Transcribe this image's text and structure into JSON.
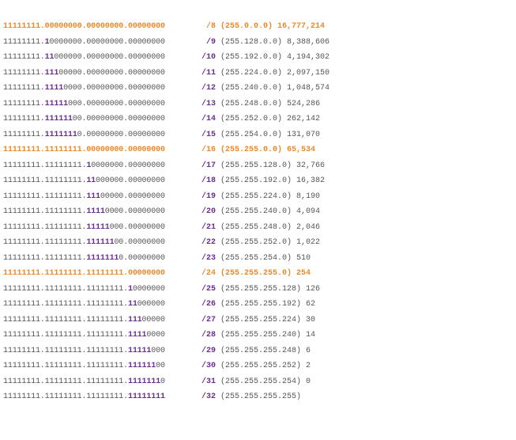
{
  "colors": {
    "text": "#555555",
    "subnet_bits": "#6a2c8f",
    "octet_boundary": "#e8892b"
  },
  "rows": [
    {
      "prefix": "/8",
      "mask": "(255.0.0.0)",
      "hosts": "16,777,214",
      "bits_net": "11111111.",
      "bits_sub": "",
      "bits_rest": "00000000.00000000.00000000",
      "octet_boundary": true
    },
    {
      "prefix": "/9",
      "mask": "(255.128.0.0)",
      "hosts": "8,388,606",
      "bits_net": "11111111.",
      "bits_sub": "1",
      "bits_rest": "0000000.00000000.00000000",
      "octet_boundary": false
    },
    {
      "prefix": "/10",
      "mask": "(255.192.0.0)",
      "hosts": "4,194,302",
      "bits_net": "11111111.",
      "bits_sub": "11",
      "bits_rest": "000000.00000000.00000000",
      "octet_boundary": false
    },
    {
      "prefix": "/11",
      "mask": "(255.224.0.0)",
      "hosts": "2,097,150",
      "bits_net": "11111111.",
      "bits_sub": "111",
      "bits_rest": "00000.00000000.00000000",
      "octet_boundary": false
    },
    {
      "prefix": "/12",
      "mask": "(255.240.0.0)",
      "hosts": "1,048,574",
      "bits_net": "11111111.",
      "bits_sub": "1111",
      "bits_rest": "0000.00000000.00000000",
      "octet_boundary": false
    },
    {
      "prefix": "/13",
      "mask": "(255.248.0.0)",
      "hosts": "524,286",
      "bits_net": "11111111.",
      "bits_sub": "11111",
      "bits_rest": "000.00000000.00000000",
      "octet_boundary": false
    },
    {
      "prefix": "/14",
      "mask": "(255.252.0.0)",
      "hosts": "262,142",
      "bits_net": "11111111.",
      "bits_sub": "111111",
      "bits_rest": "00.00000000.00000000",
      "octet_boundary": false
    },
    {
      "prefix": "/15",
      "mask": "(255.254.0.0)",
      "hosts": "131,070",
      "bits_net": "11111111.",
      "bits_sub": "1111111",
      "bits_rest": "0.00000000.00000000",
      "octet_boundary": false
    },
    {
      "prefix": "/16",
      "mask": "(255.255.0.0)",
      "hosts": "65,534",
      "bits_net": "11111111.11111111.",
      "bits_sub": "",
      "bits_rest": "00000000.00000000",
      "octet_boundary": true
    },
    {
      "prefix": "/17",
      "mask": "(255.255.128.0)",
      "hosts": "32,766",
      "bits_net": "11111111.11111111.",
      "bits_sub": "1",
      "bits_rest": "0000000.00000000",
      "octet_boundary": false
    },
    {
      "prefix": "/18",
      "mask": "(255.255.192.0)",
      "hosts": "16,382",
      "bits_net": "11111111.11111111.",
      "bits_sub": "11",
      "bits_rest": "000000.00000000",
      "octet_boundary": false
    },
    {
      "prefix": "/19",
      "mask": "(255.255.224.0)",
      "hosts": "8,190",
      "bits_net": "11111111.11111111.",
      "bits_sub": "111",
      "bits_rest": "00000.00000000",
      "octet_boundary": false
    },
    {
      "prefix": "/20",
      "mask": "(255.255.240.0)",
      "hosts": "4,094",
      "bits_net": "11111111.11111111.",
      "bits_sub": "1111",
      "bits_rest": "0000.00000000",
      "octet_boundary": false
    },
    {
      "prefix": "/21",
      "mask": "(255.255.248.0)",
      "hosts": "2,046",
      "bits_net": "11111111.11111111.",
      "bits_sub": "11111",
      "bits_rest": "000.00000000",
      "octet_boundary": false
    },
    {
      "prefix": "/22",
      "mask": "(255.255.252.0)",
      "hosts": "1,022",
      "bits_net": "11111111.11111111.",
      "bits_sub": "111111",
      "bits_rest": "00.00000000",
      "octet_boundary": false
    },
    {
      "prefix": "/23",
      "mask": "(255.255.254.0)",
      "hosts": "510",
      "bits_net": "11111111.11111111.",
      "bits_sub": "1111111",
      "bits_rest": "0.00000000",
      "octet_boundary": false
    },
    {
      "prefix": "/24",
      "mask": "(255.255.255.0)",
      "hosts": "254",
      "bits_net": "11111111.11111111.11111111.",
      "bits_sub": "",
      "bits_rest": "00000000",
      "octet_boundary": true
    },
    {
      "prefix": "/25",
      "mask": "(255.255.255.128)",
      "hosts": "126",
      "bits_net": "11111111.11111111.11111111.",
      "bits_sub": "1",
      "bits_rest": "0000000",
      "octet_boundary": false
    },
    {
      "prefix": "/26",
      "mask": "(255.255.255.192)",
      "hosts": "62",
      "bits_net": "11111111.11111111.11111111.",
      "bits_sub": "11",
      "bits_rest": "000000",
      "octet_boundary": false
    },
    {
      "prefix": "/27",
      "mask": "(255.255.255.224)",
      "hosts": "30",
      "bits_net": "11111111.11111111.11111111.",
      "bits_sub": "111",
      "bits_rest": "00000",
      "octet_boundary": false
    },
    {
      "prefix": "/28",
      "mask": "(255.255.255.240)",
      "hosts": "14",
      "bits_net": "11111111.11111111.11111111.",
      "bits_sub": "1111",
      "bits_rest": "0000",
      "octet_boundary": false
    },
    {
      "prefix": "/29",
      "mask": "(255.255.255.248)",
      "hosts": "6",
      "bits_net": "11111111.11111111.11111111.",
      "bits_sub": "11111",
      "bits_rest": "000",
      "octet_boundary": false
    },
    {
      "prefix": "/30",
      "mask": "(255.255.255.252)",
      "hosts": "2",
      "bits_net": "11111111.11111111.11111111.",
      "bits_sub": "111111",
      "bits_rest": "00",
      "octet_boundary": false
    },
    {
      "prefix": "/31",
      "mask": "(255.255.255.254)",
      "hosts": "0",
      "bits_net": "11111111.11111111.11111111.",
      "bits_sub": "1111111",
      "bits_rest": "0",
      "octet_boundary": false
    },
    {
      "prefix": "/32",
      "mask": "(255.255.255.255)",
      "hosts": "",
      "bits_net": "11111111.11111111.11111111.",
      "bits_sub": "11111111",
      "bits_rest": "",
      "octet_boundary": false
    }
  ]
}
